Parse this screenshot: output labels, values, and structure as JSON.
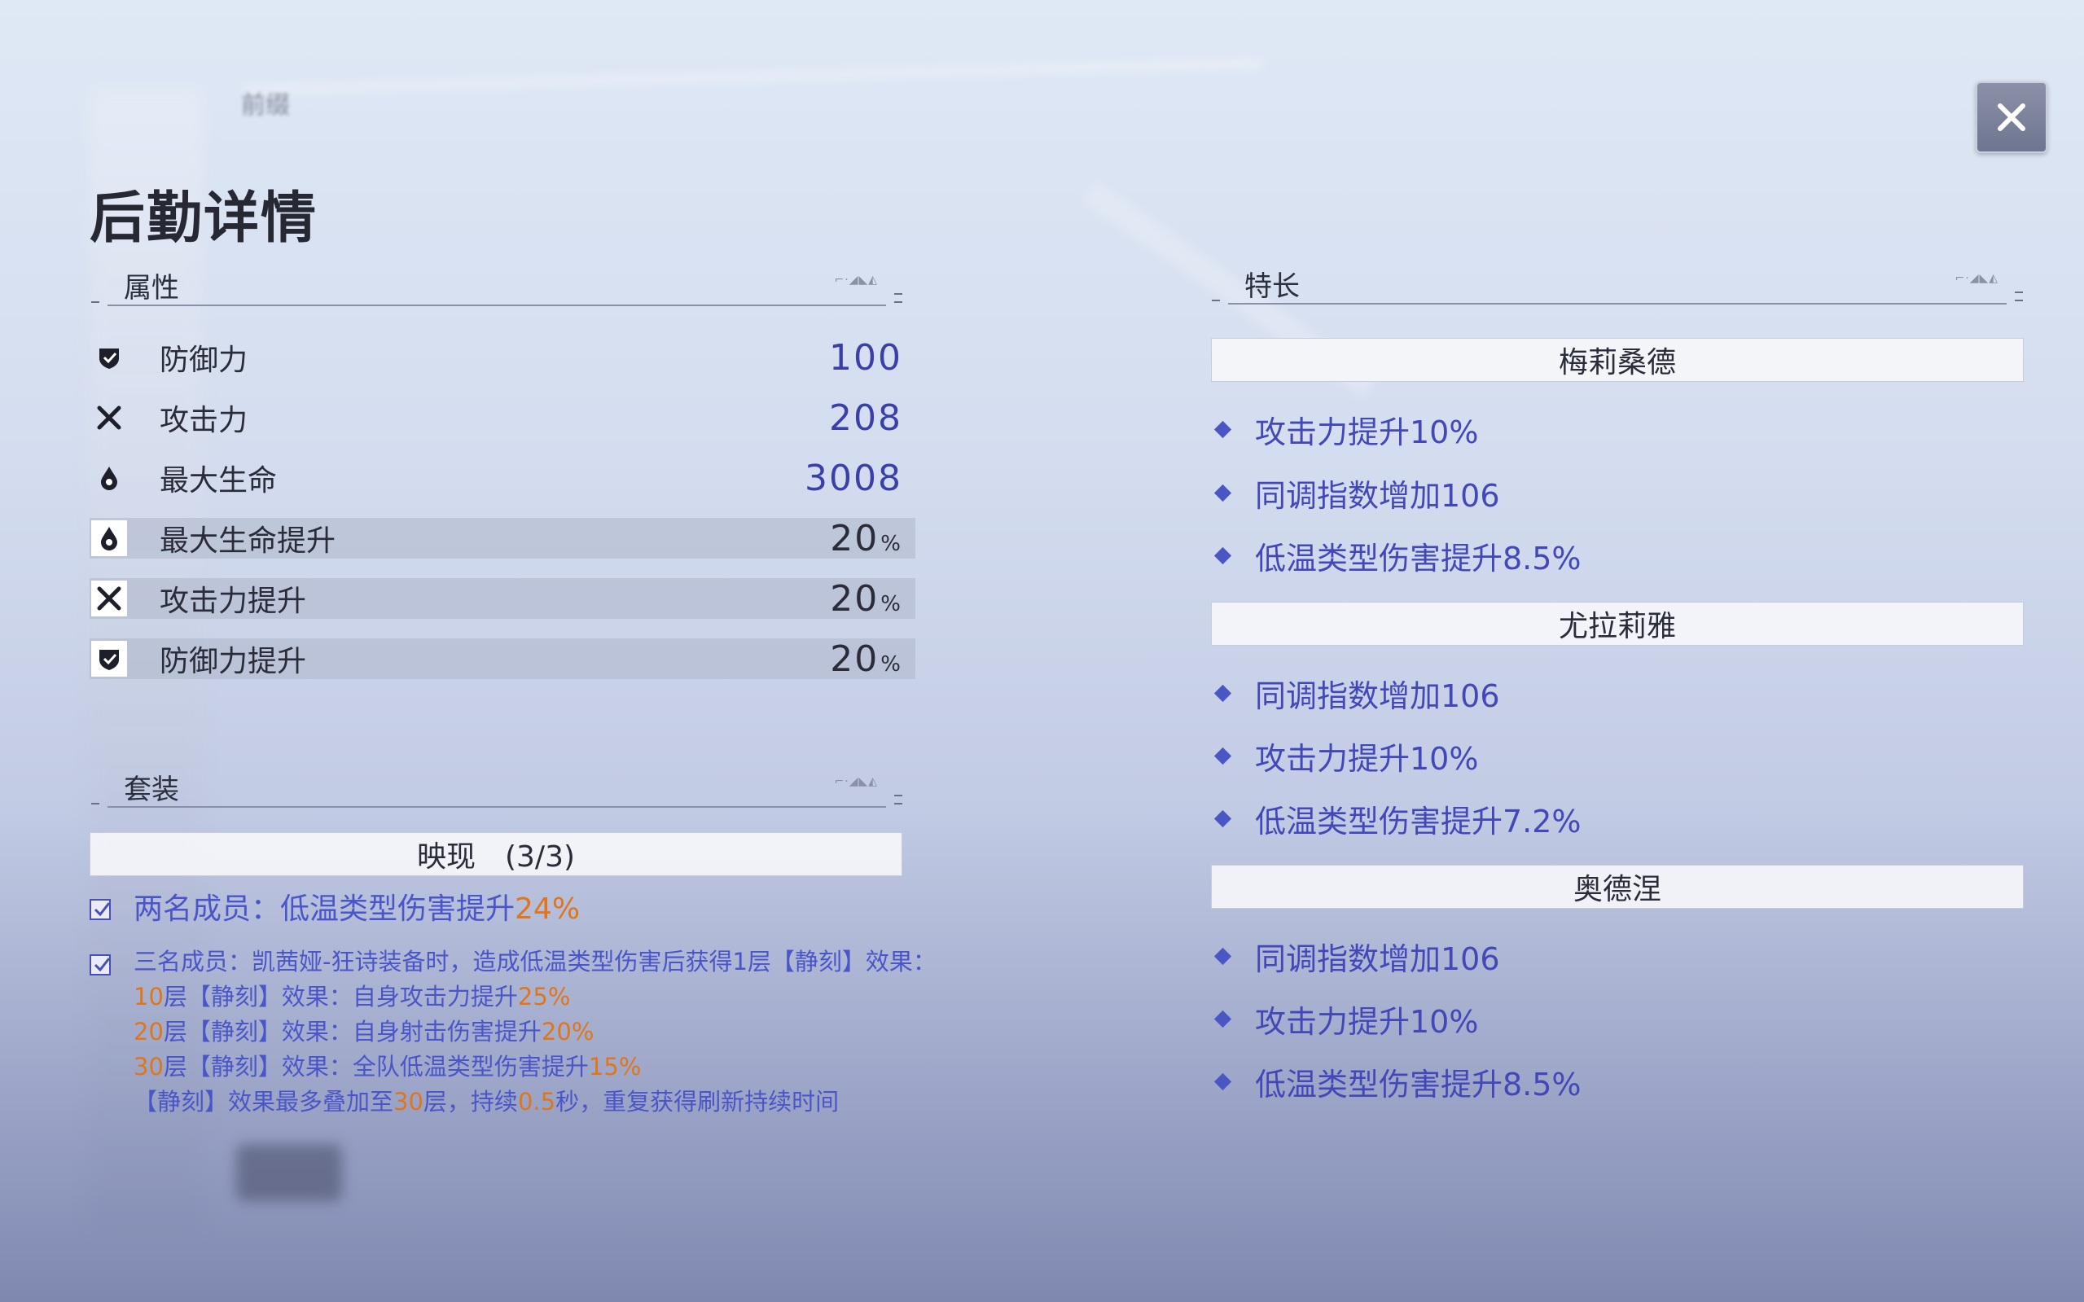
{
  "title": "后勤详情",
  "top_deco_text": "前缀",
  "close_label": "✕",
  "attributes": {
    "header": "属性",
    "rows": [
      {
        "icon": "shield-icon",
        "name": "防御力",
        "value": "100",
        "unit": ""
      },
      {
        "icon": "swords-icon",
        "name": "攻击力",
        "value": "208",
        "unit": ""
      },
      {
        "icon": "drop-icon",
        "name": "最大生命",
        "value": "3008",
        "unit": ""
      },
      {
        "icon": "drop-icon",
        "name": "最大生命提升",
        "value": "20",
        "unit": "%"
      },
      {
        "icon": "swords-icon",
        "name": "攻击力提升",
        "value": "20",
        "unit": "%"
      },
      {
        "icon": "shield-icon",
        "name": "防御力提升",
        "value": "20",
        "unit": "%"
      }
    ]
  },
  "set": {
    "header": "套装",
    "bar_label": "映现　(3/3)",
    "two_member": {
      "prefix": "两名成员：低温类型伤害提升",
      "pct": "24%"
    },
    "three_member": {
      "line1": "三名成员：凯茜娅-狂诗装备时，造成低温类型伤害后获得1层【静刻】效果：",
      "l10_num": "10",
      "l10_text": "层【静刻】效果：自身攻击力提升",
      "l10_pct": "25%",
      "l20_num": "20",
      "l20_text": "层【静刻】效果：自身射击伤害提升",
      "l20_pct": "20%",
      "l30_num": "30",
      "l30_text": "层【静刻】效果：全队低温类型伤害提升",
      "l30_pct": "15%",
      "last_a": "【静刻】效果最多叠加至",
      "last_b": "30",
      "last_c": "层，持续",
      "last_d": "0.5",
      "last_e": "秒，重复获得刷新持续时间"
    }
  },
  "specialties": {
    "header": "特长",
    "groups": [
      {
        "name": "梅莉桑德",
        "perks": [
          "攻击力提升10%",
          "同调指数增加106",
          "低温类型伤害提升8.5%"
        ]
      },
      {
        "name": "尤拉莉雅",
        "perks": [
          "同调指数增加106",
          "攻击力提升10%",
          "低温类型伤害提升7.2%"
        ]
      },
      {
        "name": "奥德涅",
        "perks": [
          "同调指数增加106",
          "攻击力提升10%",
          "低温类型伤害提升8.5%"
        ]
      }
    ]
  },
  "colors": {
    "accent": "#4347b8",
    "highlight": "#e0761a"
  }
}
